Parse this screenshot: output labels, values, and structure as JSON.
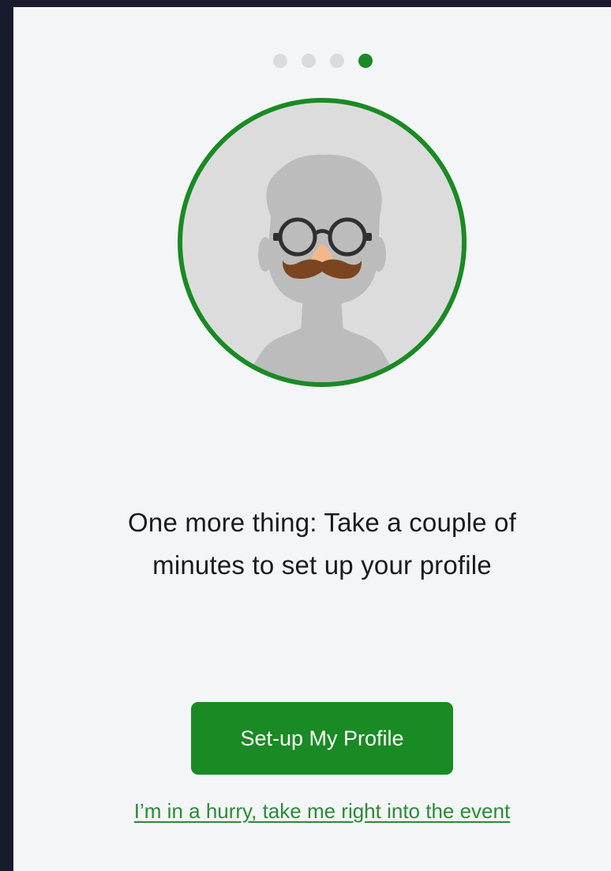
{
  "onboarding": {
    "steps_total": 4,
    "current_step": 4,
    "title": "One more thing: Take a couple of minutes to set up your profile",
    "primary_button_label": "Set-up My Profile",
    "skip_link_label": "I’m in a hurry, take me right into the event"
  },
  "colors": {
    "accent": "#1a8a24",
    "panel_background": "#f4f5f7",
    "page_background": "#181a2e",
    "dot_inactive": "#dadbdd",
    "link": "#2b8a3a"
  },
  "icons": {
    "avatar": "placeholder-avatar-icon"
  }
}
